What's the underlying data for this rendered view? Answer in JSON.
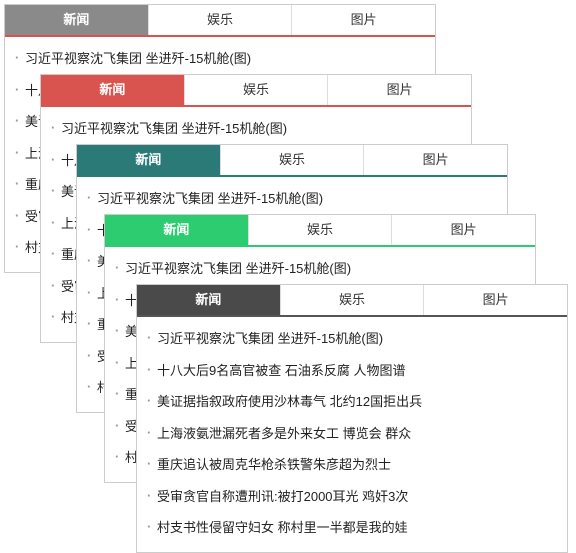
{
  "tabs": [
    "新闻",
    "娱乐",
    "图片"
  ],
  "panels": [
    {
      "theme": "c-gray"
    },
    {
      "theme": "c-red"
    },
    {
      "theme": "c-teal"
    },
    {
      "theme": "c-green"
    },
    {
      "theme": "c-dark"
    }
  ],
  "items": [
    "习近平视察沈飞集团 坐进歼-15机舱(图)",
    "十八大后9名高官被查 石油系反腐 人物图谱",
    "美证据指叙政府使用沙林毒气 北约12国拒出兵",
    "上海液氨泄漏死者多是外来女工 博览会 群众",
    "重庆追认被周克华枪杀铁警朱彦超为烈士",
    "受审贪官自称遭刑讯:被打2000耳光 鸡奸3次",
    "村支书性侵留守妇女 称村里一半都是我的娃"
  ]
}
